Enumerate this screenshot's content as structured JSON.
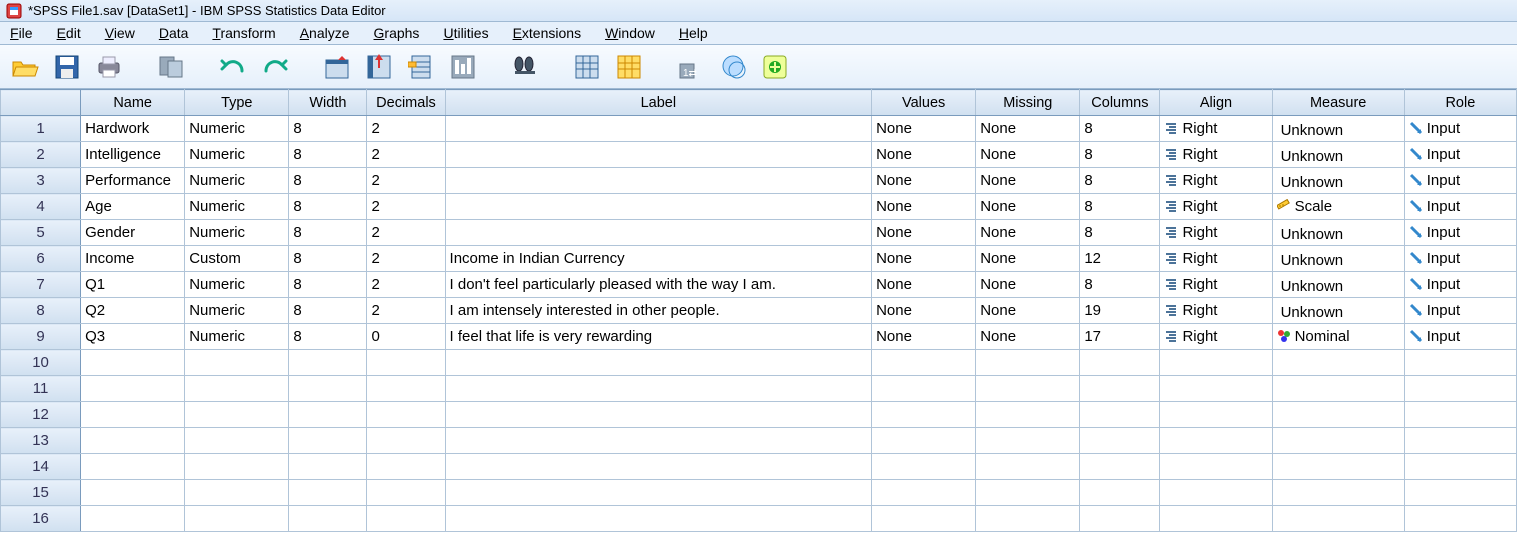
{
  "window": {
    "title": "*SPSS File1.sav [DataSet1] - IBM SPSS Statistics Data Editor"
  },
  "menus": [
    "File",
    "Edit",
    "View",
    "Data",
    "Transform",
    "Analyze",
    "Graphs",
    "Utilities",
    "Extensions",
    "Window",
    "Help"
  ],
  "columns": [
    "Name",
    "Type",
    "Width",
    "Decimals",
    "Label",
    "Values",
    "Missing",
    "Columns",
    "Align",
    "Measure",
    "Role"
  ],
  "empty_rows": 7,
  "rows": [
    {
      "n": "1",
      "name": "Hardwork",
      "type": "Numeric",
      "width": "8",
      "dec": "2",
      "label": "",
      "values": "None",
      "missing": "None",
      "cols": "8",
      "align": "Right",
      "measure": "Unknown",
      "role": "Input"
    },
    {
      "n": "2",
      "name": "Intelligence",
      "type": "Numeric",
      "width": "8",
      "dec": "2",
      "label": "",
      "values": "None",
      "missing": "None",
      "cols": "8",
      "align": "Right",
      "measure": "Unknown",
      "role": "Input"
    },
    {
      "n": "3",
      "name": "Performance",
      "type": "Numeric",
      "width": "8",
      "dec": "2",
      "label": "",
      "values": "None",
      "missing": "None",
      "cols": "8",
      "align": "Right",
      "measure": "Unknown",
      "role": "Input"
    },
    {
      "n": "4",
      "name": "Age",
      "type": "Numeric",
      "width": "8",
      "dec": "2",
      "label": "",
      "values": "None",
      "missing": "None",
      "cols": "8",
      "align": "Right",
      "measure": "Scale",
      "role": "Input"
    },
    {
      "n": "5",
      "name": "Gender",
      "type": "Numeric",
      "width": "8",
      "dec": "2",
      "label": "",
      "values": "None",
      "missing": "None",
      "cols": "8",
      "align": "Right",
      "measure": "Unknown",
      "role": "Input"
    },
    {
      "n": "6",
      "name": "Income",
      "type": "Custom",
      "width": "8",
      "dec": "2",
      "label": "Income in Indian Currency",
      "values": "None",
      "missing": "None",
      "cols": "12",
      "align": "Right",
      "measure": "Unknown",
      "role": "Input"
    },
    {
      "n": "7",
      "name": "Q1",
      "type": "Numeric",
      "width": "8",
      "dec": "2",
      "label": "I don't feel particularly pleased with the way I am.",
      "values": "None",
      "missing": "None",
      "cols": "8",
      "align": "Right",
      "measure": "Unknown",
      "role": "Input"
    },
    {
      "n": "8",
      "name": "Q2",
      "type": "Numeric",
      "width": "8",
      "dec": "2",
      "label": "I am intensely interested in other people.",
      "values": "None",
      "missing": "None",
      "cols": "19",
      "align": "Right",
      "measure": "Unknown",
      "role": "Input"
    },
    {
      "n": "9",
      "name": "Q3",
      "type": "Numeric",
      "width": "8",
      "dec": "0",
      "label": "I feel that life is very rewarding",
      "values": "None",
      "missing": "None",
      "cols": "17",
      "align": "Right",
      "measure": "Nominal",
      "role": "Input"
    }
  ]
}
